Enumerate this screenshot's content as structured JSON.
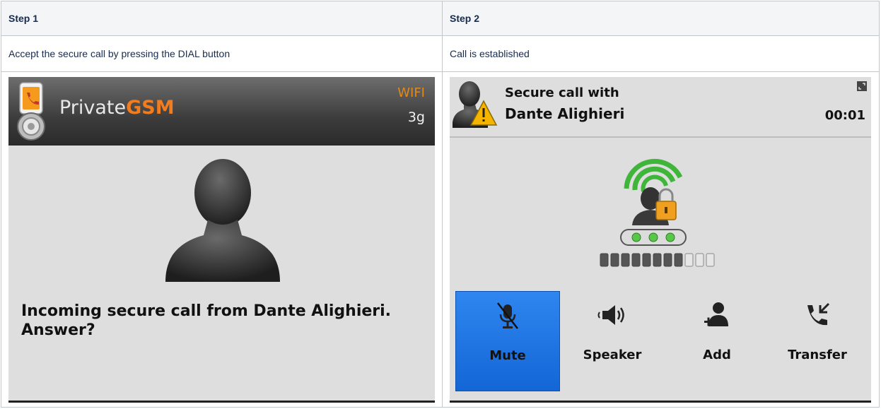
{
  "table": {
    "headers": [
      "Step 1",
      "Step 2"
    ],
    "descriptions": [
      "Accept the secure call by pressing the DIAL button",
      "Call is established"
    ]
  },
  "step1_screen": {
    "brand_prefix": "Private",
    "brand_suffix": "GSM",
    "wifi_label": "WIFI",
    "network_label": "3g",
    "message": "Incoming secure call from Dante Alighieri. Answer?",
    "colors": {
      "header_dark": "#2a2a2a",
      "brand_accent": "#f07d1f",
      "screen_bg": "#dedede"
    }
  },
  "step2_screen": {
    "title_line1": "Secure call with",
    "title_line2": "Dante Alighieri",
    "timer": "00:01",
    "signal_level": {
      "filled": 8,
      "total": 11
    },
    "buttons": [
      {
        "label": "Mute",
        "icon": "microphone-muted-icon",
        "active": true
      },
      {
        "label": "Speaker",
        "icon": "speaker-icon",
        "active": false
      },
      {
        "label": "Add",
        "icon": "add-user-icon",
        "active": false
      },
      {
        "label": "Transfer",
        "icon": "phone-transfer-icon",
        "active": false
      }
    ],
    "colors": {
      "active_button": "#1f74e4",
      "secure_green": "#3fb53a",
      "lock_orange": "#f0a020"
    }
  }
}
